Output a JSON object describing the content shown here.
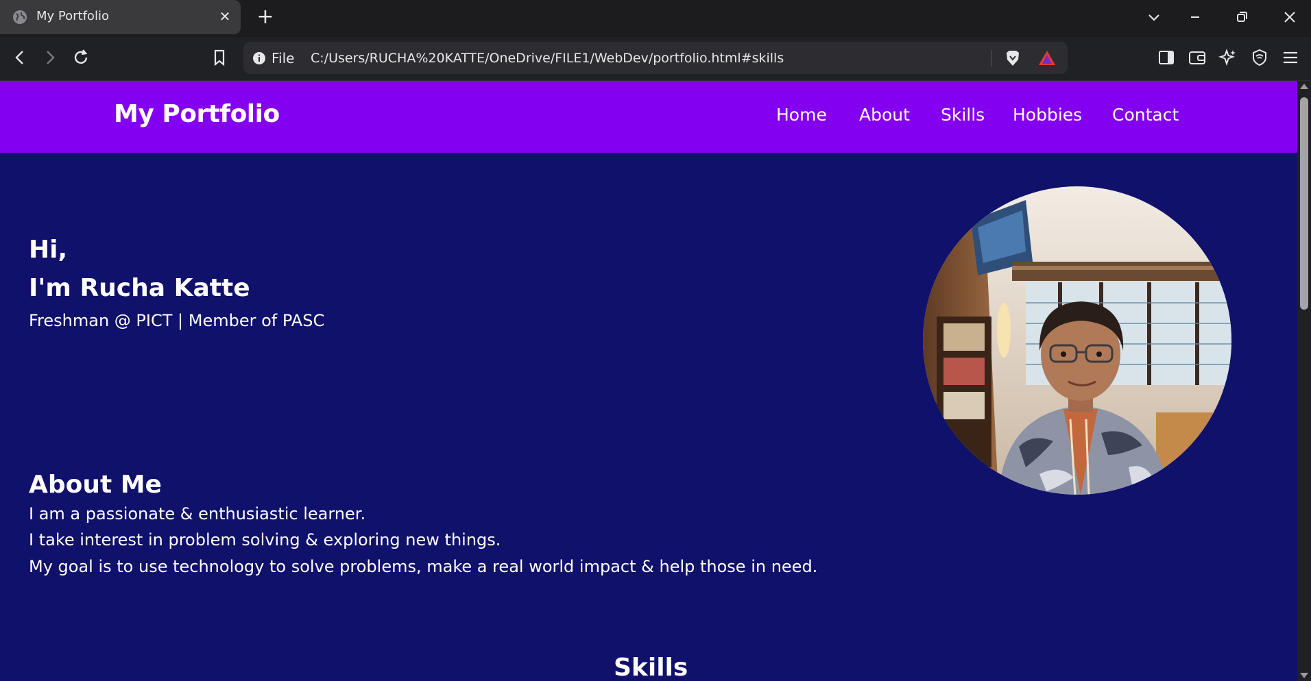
{
  "browser": {
    "tab": {
      "title": "My Portfolio",
      "close_glyph": "✕"
    },
    "new_tab_glyph": "+",
    "address_bar": {
      "scheme_label": "File",
      "url": "C:/Users/RUCHA%20KATTE/OneDrive/FILE1/WebDev/portfolio.html#skills"
    },
    "icons": [
      "globe-icon",
      "close-icon",
      "new-tab-icon",
      "tab-search-icon",
      "minimize-icon",
      "restore-icon",
      "window-close-icon",
      "back-icon",
      "forward-icon",
      "reload-icon",
      "bookmark-icon",
      "info-icon",
      "brave-shields-icon",
      "brave-rewards-icon",
      "sidebar-icon",
      "wallet-icon",
      "leo-ai-icon",
      "vpn-shield-icon",
      "menu-icon"
    ]
  },
  "page": {
    "brand": "My Portfolio",
    "nav": [
      {
        "label": "Home"
      },
      {
        "label": "About"
      },
      {
        "label": "Skills"
      },
      {
        "label": "Hobbies"
      },
      {
        "label": "Contact"
      }
    ],
    "hero": {
      "greeting": "Hi,",
      "name": "I'm Rucha Katte",
      "tagline": "Freshman @ PICT | Member of PASC"
    },
    "about": {
      "heading": "About Me",
      "lines": [
        "I am a passionate & enthusiastic learner.",
        "I take interest in problem solving & exploring new things.",
        "My goal is to use technology to solve problems, make a real world impact & help those in need."
      ]
    },
    "skills": {
      "heading": "Skills"
    }
  },
  "colors": {
    "navbar": "#8400f0",
    "page_background": "#10116b",
    "browser_chrome": "#1c1c1f",
    "text": "#ffffff"
  }
}
